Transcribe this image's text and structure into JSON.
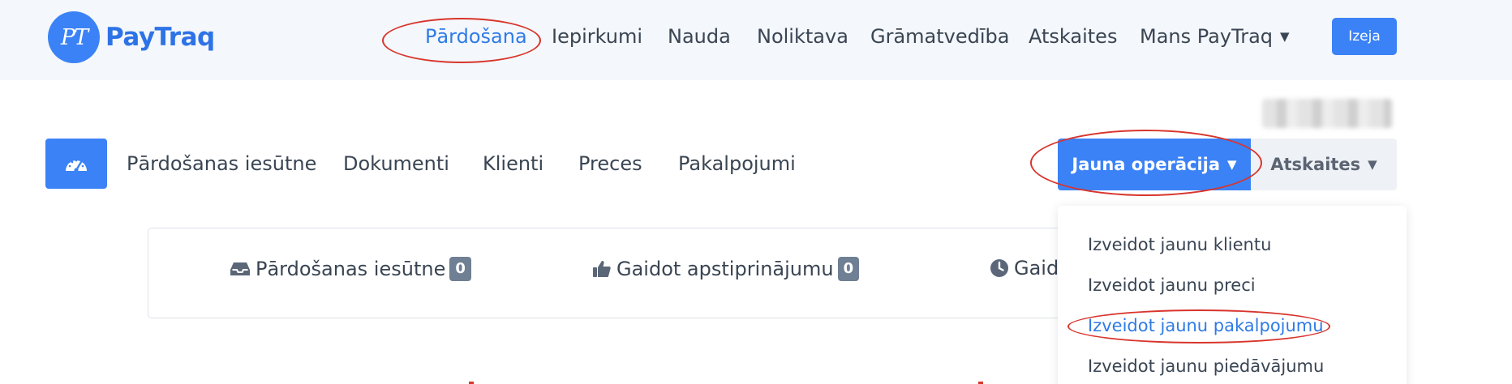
{
  "brand": {
    "logo_mark": "PT",
    "name": "PayTraq"
  },
  "topnav": {
    "items": [
      {
        "label": "Pārdošana",
        "active": true
      },
      {
        "label": "Iepirkumi"
      },
      {
        "label": "Nauda"
      },
      {
        "label": "Noliktava"
      },
      {
        "label": "Grāmatvedība"
      },
      {
        "label": "Atskaites"
      },
      {
        "label": "Mans PayTraq",
        "has_dropdown": true
      }
    ],
    "exit_label": "Izeja"
  },
  "subnav": {
    "dashboard_icon": "speedometer-icon",
    "items": [
      {
        "label": "Pārdošanas iesūtne"
      },
      {
        "label": "Dokumenti"
      },
      {
        "label": "Klienti"
      },
      {
        "label": "Preces"
      },
      {
        "label": "Pakalpojumi"
      }
    ],
    "new_operation_label": "Jauna operācija",
    "reports_label": "Atskaites"
  },
  "stats": [
    {
      "icon": "inbox-icon",
      "label": "Pārdošanas iesūtne",
      "count": "0"
    },
    {
      "icon": "thumbs-up-icon",
      "label": "Gaidot apstiprinājumu",
      "count": "0"
    },
    {
      "icon": "clock-icon",
      "label": "Gaid"
    }
  ],
  "dropdown": {
    "items": [
      {
        "label": "Izveidot jaunu klientu"
      },
      {
        "label": "Izveidot jaunu preci"
      },
      {
        "label": "Izveidot jaunu pakalpojumu",
        "highlighted": true
      },
      {
        "label": "Izveidot jaunu piedāvājumu"
      }
    ]
  },
  "colors": {
    "accent": "#3b82f6",
    "annotation": "#d8352c",
    "badge": "#6f7f94"
  }
}
